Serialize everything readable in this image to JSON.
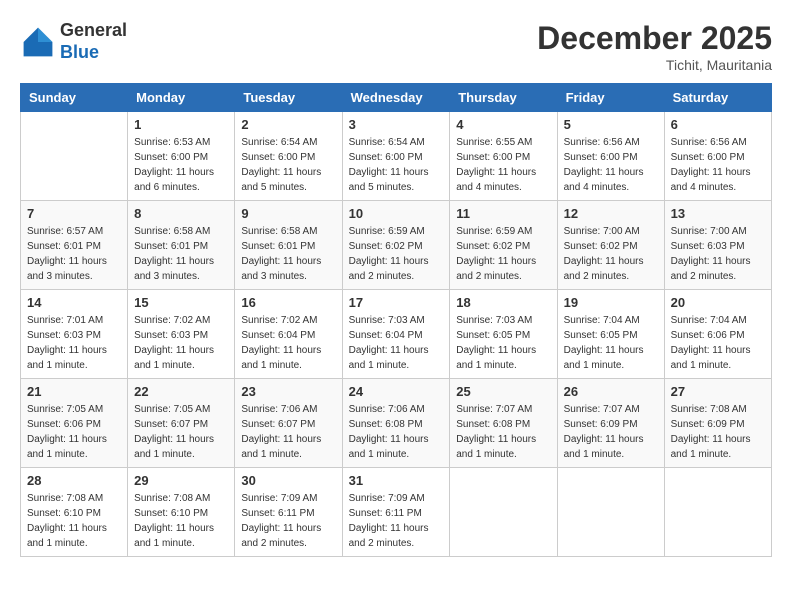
{
  "header": {
    "logo_general": "General",
    "logo_blue": "Blue",
    "month_title": "December 2025",
    "location": "Tichit, Mauritania"
  },
  "calendar": {
    "days_of_week": [
      "Sunday",
      "Monday",
      "Tuesday",
      "Wednesday",
      "Thursday",
      "Friday",
      "Saturday"
    ],
    "weeks": [
      [
        {
          "day": "",
          "sunrise": "",
          "sunset": "",
          "daylight": ""
        },
        {
          "day": "1",
          "sunrise": "Sunrise: 6:53 AM",
          "sunset": "Sunset: 6:00 PM",
          "daylight": "Daylight: 11 hours and 6 minutes."
        },
        {
          "day": "2",
          "sunrise": "Sunrise: 6:54 AM",
          "sunset": "Sunset: 6:00 PM",
          "daylight": "Daylight: 11 hours and 5 minutes."
        },
        {
          "day": "3",
          "sunrise": "Sunrise: 6:54 AM",
          "sunset": "Sunset: 6:00 PM",
          "daylight": "Daylight: 11 hours and 5 minutes."
        },
        {
          "day": "4",
          "sunrise": "Sunrise: 6:55 AM",
          "sunset": "Sunset: 6:00 PM",
          "daylight": "Daylight: 11 hours and 4 minutes."
        },
        {
          "day": "5",
          "sunrise": "Sunrise: 6:56 AM",
          "sunset": "Sunset: 6:00 PM",
          "daylight": "Daylight: 11 hours and 4 minutes."
        },
        {
          "day": "6",
          "sunrise": "Sunrise: 6:56 AM",
          "sunset": "Sunset: 6:00 PM",
          "daylight": "Daylight: 11 hours and 4 minutes."
        }
      ],
      [
        {
          "day": "7",
          "sunrise": "Sunrise: 6:57 AM",
          "sunset": "Sunset: 6:01 PM",
          "daylight": "Daylight: 11 hours and 3 minutes."
        },
        {
          "day": "8",
          "sunrise": "Sunrise: 6:58 AM",
          "sunset": "Sunset: 6:01 PM",
          "daylight": "Daylight: 11 hours and 3 minutes."
        },
        {
          "day": "9",
          "sunrise": "Sunrise: 6:58 AM",
          "sunset": "Sunset: 6:01 PM",
          "daylight": "Daylight: 11 hours and 3 minutes."
        },
        {
          "day": "10",
          "sunrise": "Sunrise: 6:59 AM",
          "sunset": "Sunset: 6:02 PM",
          "daylight": "Daylight: 11 hours and 2 minutes."
        },
        {
          "day": "11",
          "sunrise": "Sunrise: 6:59 AM",
          "sunset": "Sunset: 6:02 PM",
          "daylight": "Daylight: 11 hours and 2 minutes."
        },
        {
          "day": "12",
          "sunrise": "Sunrise: 7:00 AM",
          "sunset": "Sunset: 6:02 PM",
          "daylight": "Daylight: 11 hours and 2 minutes."
        },
        {
          "day": "13",
          "sunrise": "Sunrise: 7:00 AM",
          "sunset": "Sunset: 6:03 PM",
          "daylight": "Daylight: 11 hours and 2 minutes."
        }
      ],
      [
        {
          "day": "14",
          "sunrise": "Sunrise: 7:01 AM",
          "sunset": "Sunset: 6:03 PM",
          "daylight": "Daylight: 11 hours and 1 minute."
        },
        {
          "day": "15",
          "sunrise": "Sunrise: 7:02 AM",
          "sunset": "Sunset: 6:03 PM",
          "daylight": "Daylight: 11 hours and 1 minute."
        },
        {
          "day": "16",
          "sunrise": "Sunrise: 7:02 AM",
          "sunset": "Sunset: 6:04 PM",
          "daylight": "Daylight: 11 hours and 1 minute."
        },
        {
          "day": "17",
          "sunrise": "Sunrise: 7:03 AM",
          "sunset": "Sunset: 6:04 PM",
          "daylight": "Daylight: 11 hours and 1 minute."
        },
        {
          "day": "18",
          "sunrise": "Sunrise: 7:03 AM",
          "sunset": "Sunset: 6:05 PM",
          "daylight": "Daylight: 11 hours and 1 minute."
        },
        {
          "day": "19",
          "sunrise": "Sunrise: 7:04 AM",
          "sunset": "Sunset: 6:05 PM",
          "daylight": "Daylight: 11 hours and 1 minute."
        },
        {
          "day": "20",
          "sunrise": "Sunrise: 7:04 AM",
          "sunset": "Sunset: 6:06 PM",
          "daylight": "Daylight: 11 hours and 1 minute."
        }
      ],
      [
        {
          "day": "21",
          "sunrise": "Sunrise: 7:05 AM",
          "sunset": "Sunset: 6:06 PM",
          "daylight": "Daylight: 11 hours and 1 minute."
        },
        {
          "day": "22",
          "sunrise": "Sunrise: 7:05 AM",
          "sunset": "Sunset: 6:07 PM",
          "daylight": "Daylight: 11 hours and 1 minute."
        },
        {
          "day": "23",
          "sunrise": "Sunrise: 7:06 AM",
          "sunset": "Sunset: 6:07 PM",
          "daylight": "Daylight: 11 hours and 1 minute."
        },
        {
          "day": "24",
          "sunrise": "Sunrise: 7:06 AM",
          "sunset": "Sunset: 6:08 PM",
          "daylight": "Daylight: 11 hours and 1 minute."
        },
        {
          "day": "25",
          "sunrise": "Sunrise: 7:07 AM",
          "sunset": "Sunset: 6:08 PM",
          "daylight": "Daylight: 11 hours and 1 minute."
        },
        {
          "day": "26",
          "sunrise": "Sunrise: 7:07 AM",
          "sunset": "Sunset: 6:09 PM",
          "daylight": "Daylight: 11 hours and 1 minute."
        },
        {
          "day": "27",
          "sunrise": "Sunrise: 7:08 AM",
          "sunset": "Sunset: 6:09 PM",
          "daylight": "Daylight: 11 hours and 1 minute."
        }
      ],
      [
        {
          "day": "28",
          "sunrise": "Sunrise: 7:08 AM",
          "sunset": "Sunset: 6:10 PM",
          "daylight": "Daylight: 11 hours and 1 minute."
        },
        {
          "day": "29",
          "sunrise": "Sunrise: 7:08 AM",
          "sunset": "Sunset: 6:10 PM",
          "daylight": "Daylight: 11 hours and 1 minute."
        },
        {
          "day": "30",
          "sunrise": "Sunrise: 7:09 AM",
          "sunset": "Sunset: 6:11 PM",
          "daylight": "Daylight: 11 hours and 2 minutes."
        },
        {
          "day": "31",
          "sunrise": "Sunrise: 7:09 AM",
          "sunset": "Sunset: 6:11 PM",
          "daylight": "Daylight: 11 hours and 2 minutes."
        },
        {
          "day": "",
          "sunrise": "",
          "sunset": "",
          "daylight": ""
        },
        {
          "day": "",
          "sunrise": "",
          "sunset": "",
          "daylight": ""
        },
        {
          "day": "",
          "sunrise": "",
          "sunset": "",
          "daylight": ""
        }
      ]
    ]
  }
}
